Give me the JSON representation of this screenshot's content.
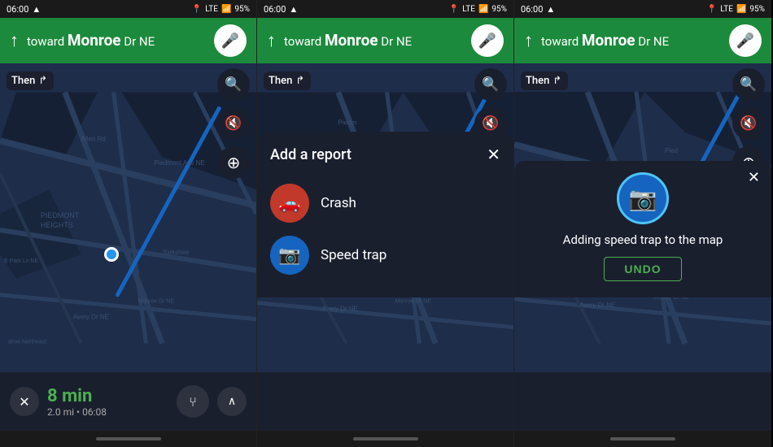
{
  "panels": [
    {
      "id": "panel1",
      "status": {
        "time": "06:00",
        "battery": "95%",
        "signal": "LTE"
      },
      "nav": {
        "toward": "toward",
        "destination": "Monroe",
        "suffix": " Dr NE"
      },
      "then_label": "Then",
      "map_buttons": [
        "search",
        "volume",
        "add-report"
      ],
      "bottom": {
        "close_label": "✕",
        "eta_time": "8 min",
        "eta_details": "2.0 mi • 06:08",
        "route_icon": "⑂",
        "expand_icon": "∧"
      }
    },
    {
      "id": "panel2",
      "status": {
        "time": "06:00",
        "battery": "95%",
        "signal": "LTE"
      },
      "nav": {
        "toward": "toward",
        "destination": "Monroe",
        "suffix": " Dr NE"
      },
      "then_label": "Then",
      "report": {
        "title": "Add a report",
        "close": "✕",
        "items": [
          {
            "icon": "🚗",
            "label": "Crash",
            "type": "crash"
          },
          {
            "icon": "📷",
            "label": "Speed trap",
            "type": "speedtrap"
          }
        ]
      }
    },
    {
      "id": "panel3",
      "status": {
        "time": "06:00",
        "battery": "95%",
        "signal": "LTE"
      },
      "nav": {
        "toward": "toward",
        "destination": "Monroe",
        "suffix": " Dr NE"
      },
      "then_label": "Then",
      "toast": {
        "text": "Adding speed trap to the map",
        "undo_label": "UNDO",
        "close": "✕"
      }
    }
  ],
  "icons": {
    "mic": "🎤",
    "up_arrow": "↑",
    "search": "🔍",
    "volume": "🔊",
    "add": "⊕",
    "close": "✕",
    "then_arrow": "↱",
    "crash": "💥",
    "speedtrap": "📷",
    "chevron_up": "^",
    "route": "⑂",
    "home_nav": "←"
  }
}
